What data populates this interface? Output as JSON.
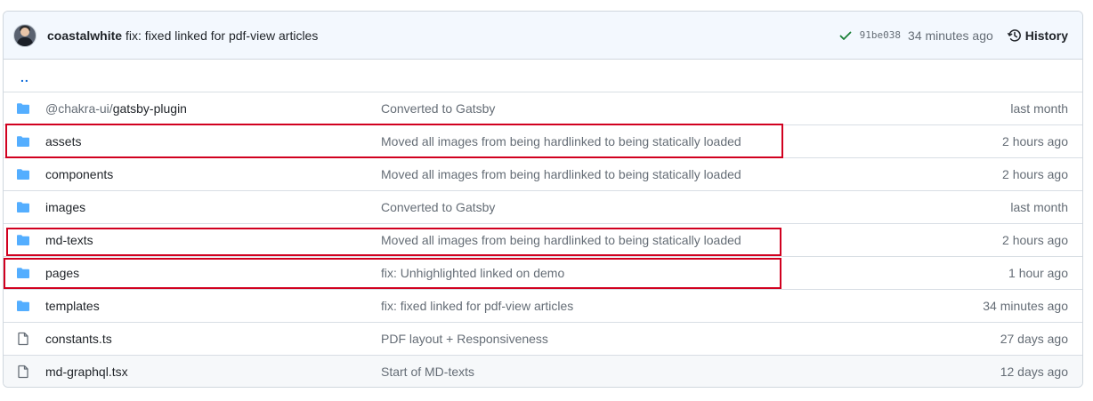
{
  "commit": {
    "author": "coastalwhite",
    "message": "fix: fixed linked for pdf-view articles",
    "sha": "91be038",
    "time": "34 minutes ago",
    "history_label": "History",
    "status_color": "#1a7f37"
  },
  "updir_label": "..",
  "colors": {
    "folder": "#54aeff",
    "file": "#656d76",
    "highlight": "#d1001f"
  },
  "files": [
    {
      "type": "folder",
      "icon": "folder-icon",
      "prefix": "@chakra-ui/",
      "name": "gatsby-plugin",
      "message": "Converted to Gatsby",
      "date": "last month"
    },
    {
      "type": "folder",
      "icon": "folder-icon",
      "prefix": "",
      "name": "assets",
      "message": "Moved all images from being hardlinked to being statically loaded",
      "date": "2 hours ago"
    },
    {
      "type": "folder",
      "icon": "folder-icon",
      "prefix": "",
      "name": "components",
      "message": "Moved all images from being hardlinked to being statically loaded",
      "date": "2 hours ago"
    },
    {
      "type": "folder",
      "icon": "folder-icon",
      "prefix": "",
      "name": "images",
      "message": "Converted to Gatsby",
      "date": "last month"
    },
    {
      "type": "folder",
      "icon": "folder-icon",
      "prefix": "",
      "name": "md-texts",
      "message": "Moved all images from being hardlinked to being statically loaded",
      "date": "2 hours ago"
    },
    {
      "type": "folder",
      "icon": "folder-icon",
      "prefix": "",
      "name": "pages",
      "message": "fix: Unhighlighted linked on demo",
      "date": "1 hour ago"
    },
    {
      "type": "folder",
      "icon": "folder-icon",
      "prefix": "",
      "name": "templates",
      "message": "fix: fixed linked for pdf-view articles",
      "date": "34 minutes ago"
    },
    {
      "type": "file",
      "icon": "file-icon",
      "prefix": "",
      "name": "constants.ts",
      "message": "PDF layout + Responsiveness",
      "date": "27 days ago"
    },
    {
      "type": "file",
      "icon": "file-icon",
      "prefix": "",
      "name": "md-graphql.tsx",
      "message": "Start of MD-texts",
      "date": "12 days ago"
    }
  ]
}
